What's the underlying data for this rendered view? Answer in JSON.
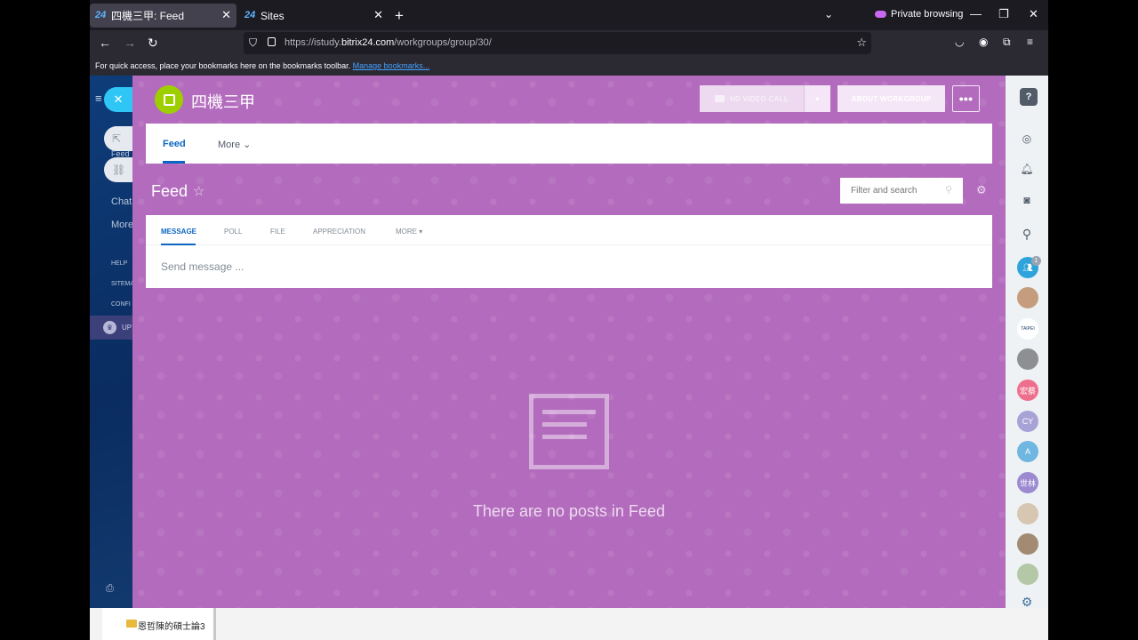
{
  "browser": {
    "tabs": [
      {
        "title": "四機三甲: Feed",
        "favicon": "24"
      },
      {
        "title": "Sites",
        "favicon": "24"
      }
    ],
    "private_label": "Private browsing",
    "url_prefix": "https://istudy.",
    "url_domain": "bitrix24.com",
    "url_path": "/workgroups/group/30/",
    "bookmark_hint": "For quick access, place your bookmarks here on the bookmarks toolbar.",
    "bookmark_link": "Manage bookmarks..."
  },
  "left_menu": {
    "items": [
      "Feed",
      "Chat",
      "More"
    ],
    "small_items": [
      "HELP",
      "SITEMA",
      "CONFI"
    ],
    "upgrade_label": "UP"
  },
  "workgroup": {
    "name": "四機三甲",
    "video_call": "HD VIDEO CALL",
    "about": "ABOUT WORKGROUP",
    "more_dots": "•••"
  },
  "subnav": {
    "feed": "Feed",
    "more": "More"
  },
  "feed": {
    "title": "Feed",
    "filter_placeholder": "Filter and search",
    "composer_tabs": [
      "MESSAGE",
      "POLL",
      "FILE",
      "APPRECIATION",
      "MORE"
    ],
    "send_placeholder": "Send message ...",
    "empty_text": "There are no posts in Feed"
  },
  "right_bar": {
    "badge_count": "1",
    "avatars": [
      {
        "label": "",
        "color": "#c59c7e"
      },
      {
        "label": "TAIPEI",
        "color": "#ffffff"
      },
      {
        "label": "",
        "color": "#8e8f92"
      },
      {
        "label": "宏蔡",
        "color": "#ee6f8c"
      },
      {
        "label": "CY",
        "color": "#a8a2d6"
      },
      {
        "label": "A",
        "color": "#6fb6e0"
      },
      {
        "label": "世林",
        "color": "#9b8ad0"
      },
      {
        "label": "",
        "color": "#d6c6b2"
      },
      {
        "label": "",
        "color": "#a38b73"
      },
      {
        "label": "",
        "color": "#b4c8a8"
      }
    ]
  },
  "taskbar": {
    "item": "恩哲陳的碩士論3"
  }
}
